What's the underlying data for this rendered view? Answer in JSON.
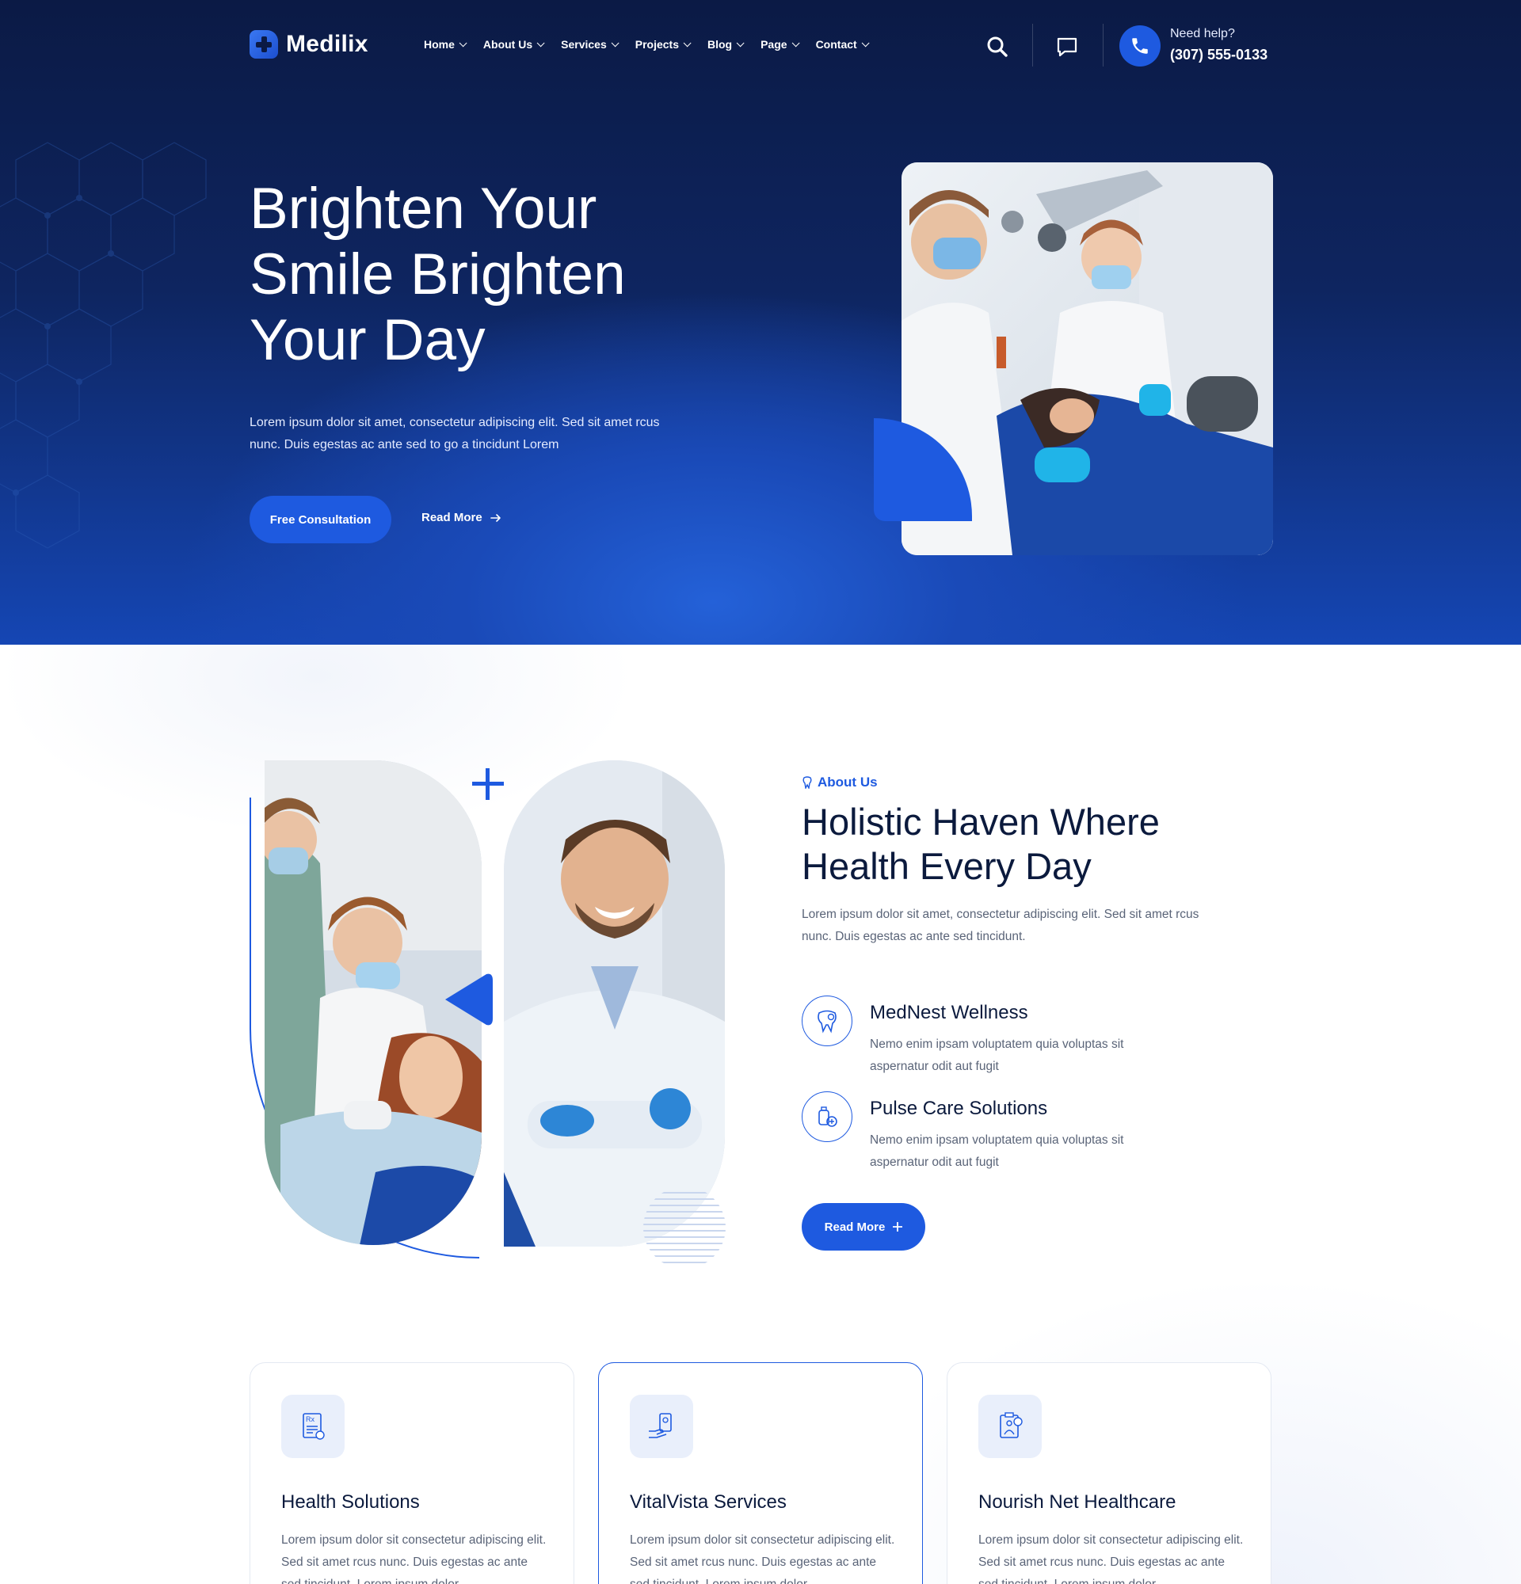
{
  "brand": {
    "name": "Medilix",
    "accent": "#1e5ae0",
    "dark": "#0b1a45"
  },
  "nav": [
    {
      "label": "Home"
    },
    {
      "label": "About Us"
    },
    {
      "label": "Services"
    },
    {
      "label": "Projects"
    },
    {
      "label": "Blog"
    },
    {
      "label": "Page"
    },
    {
      "label": "Contact"
    }
  ],
  "header_actions": {
    "search_icon": "search-icon",
    "chat_icon": "chat-icon",
    "phone_icon": "phone-icon",
    "help_label": "Need help?",
    "help_phone": "(307) 555-0133"
  },
  "hero": {
    "title": "Brighten Your Smile Brighten Your Day",
    "text": "Lorem ipsum dolor sit amet, consectetur adipiscing elit. Sed sit amet rcus nunc. Duis egestas ac ante sed to go a tincidunt Lorem",
    "primary_button": "Free Consultation",
    "secondary_link": "Read More"
  },
  "about": {
    "eyebrow": "About Us",
    "title": "Holistic Haven Where Health Every Day",
    "text": "Lorem ipsum dolor sit amet, consectetur adipiscing elit. Sed sit amet rcus nunc. Duis egestas ac ante sed tincidunt.",
    "features": [
      {
        "icon": "tooth-icon",
        "title": "MedNest Wellness",
        "text": "Nemo enim ipsam voluptatem quia voluptas sit aspernatur odit aut fugit"
      },
      {
        "icon": "medical-kit-icon",
        "title": "Pulse Care Solutions",
        "text": "Nemo enim ipsam voluptatem quia voluptas sit aspernatur odit aut fugit"
      }
    ],
    "button": "Read More"
  },
  "services": [
    {
      "icon": "prescription-icon",
      "title": "Health Solutions",
      "text": "Lorem ipsum dolor sit consectetur adipiscing elit. Sed sit amet rcus nunc. Duis egestas ac ante sed tincidunt. Lorem ipsum dolor"
    },
    {
      "icon": "hand-device-icon",
      "title": "VitalVista Services",
      "text": "Lorem ipsum dolor sit consectetur adipiscing elit. Sed sit amet rcus nunc. Duis egestas ac ante sed tincidunt. Lorem ipsum dolor"
    },
    {
      "icon": "medical-report-icon",
      "title": "Nourish Net Healthcare",
      "text": "Lorem ipsum dolor sit consectetur adipiscing elit. Sed sit amet rcus nunc. Duis egestas ac ante sed tincidunt. Lorem ipsum dolor"
    }
  ]
}
